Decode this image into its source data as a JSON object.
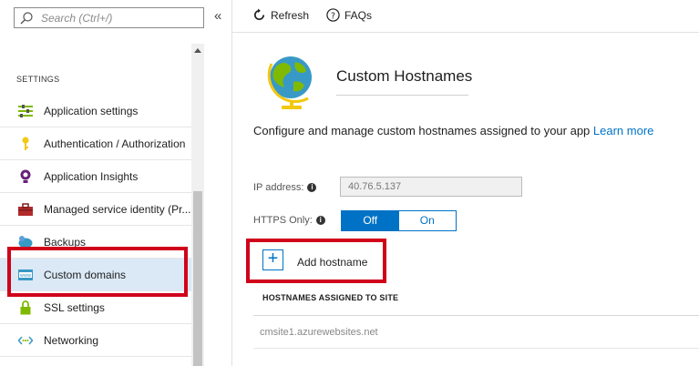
{
  "search": {
    "placeholder": "Search (Ctrl+/)",
    "icon": "search-icon"
  },
  "collapse_glyph": "«",
  "settings": {
    "section_label": "SETTINGS",
    "items": [
      {
        "label": "Application settings",
        "icon": "app-settings-icon"
      },
      {
        "label": "Authentication / Authorization",
        "icon": "key-icon"
      },
      {
        "label": "Application Insights",
        "icon": "app-insights-icon"
      },
      {
        "label": "Managed service identity (Pr...",
        "icon": "toolbox-icon"
      },
      {
        "label": "Backups",
        "icon": "backup-icon"
      },
      {
        "label": "Custom domains",
        "icon": "www-icon",
        "active": true
      },
      {
        "label": "SSL settings",
        "icon": "lock-icon"
      },
      {
        "label": "Networking",
        "icon": "networking-icon"
      }
    ]
  },
  "toolbar": {
    "refresh": "Refresh",
    "faqs": "FAQs"
  },
  "main": {
    "title": "Custom Hostnames",
    "description": "Configure and manage custom hostnames assigned to your app",
    "learn_more": "Learn more",
    "ip_label": "IP address:",
    "ip_value": "40.76.5.137",
    "https_label": "HTTPS Only:",
    "https_off": "Off",
    "https_on": "On",
    "https_selected": "Off",
    "add_hostname": "Add hostname",
    "table_header": "HOSTNAMES ASSIGNED TO SITE",
    "hostnames": [
      "cmsite1.azurewebsites.net"
    ]
  },
  "colors": {
    "accent": "#0072c6",
    "highlight": "#d0011b",
    "active_bg": "#dbe9f7"
  }
}
